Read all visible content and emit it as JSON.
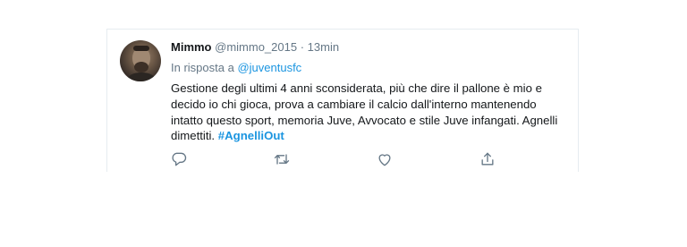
{
  "tweet": {
    "author_name": "Mimmo",
    "author_handle": "@mimmo_2015",
    "separator": "·",
    "time": "13min",
    "reply_prefix": "In risposta a",
    "reply_to": "@juventusfc",
    "text": "Gestione degli ultimi 4 anni sconsiderata, più che dire il pallone è mio e decido io chi gioca, prova a cambiare il calcio dall'interno mantenendo intatto questo sport, memoria Juve, Avvocato e stile Juve infangati. Agnelli dimettiti.",
    "hashtag": "#AgnelliOut"
  },
  "actions": [
    {
      "icon": "reply-icon"
    },
    {
      "icon": "retweet-icon"
    },
    {
      "icon": "like-icon"
    },
    {
      "icon": "share-icon"
    }
  ],
  "colors": {
    "accent": "#1b95e0",
    "text": "#14171a",
    "muted": "#657786",
    "border": "#e6ecf0"
  }
}
